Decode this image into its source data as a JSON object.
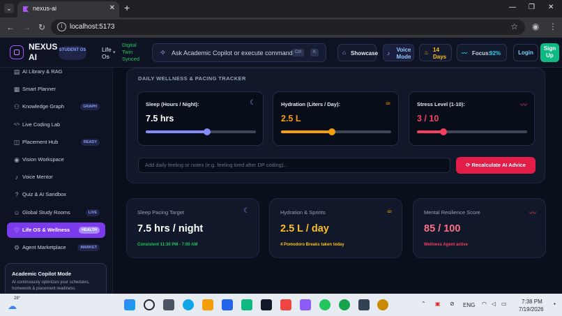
{
  "browser": {
    "tab_title": "nexus-ai",
    "url": "localhost:5173"
  },
  "topnav": {
    "brand": "NEXUS AI",
    "student_badge": "STUDENT OS",
    "life_os": "Life Os",
    "twin_status": "Digital Twin Synced",
    "command_placeholder": "Ask Academic Copilot or execute command...",
    "kbd_ctrl": "Ctrl",
    "kbd_k": "K",
    "showcase": "Showcase",
    "voice_mode": "Voice Mode",
    "streak": "14 Days",
    "focus_label": "Focus:",
    "focus_value": "92%",
    "login": "Login",
    "signup": "Sign Up"
  },
  "sidebar": {
    "items": [
      {
        "label": "AI Library & RAG",
        "icon": "book-icon"
      },
      {
        "label": "Smart Planner",
        "icon": "calendar-icon"
      },
      {
        "label": "Knowledge Graph",
        "icon": "graph-icon",
        "badge": "GRAPH"
      },
      {
        "label": "Live Coding Lab",
        "icon": "code-icon"
      },
      {
        "label": "Placement Hub",
        "icon": "briefcase-icon",
        "badge": "READY"
      },
      {
        "label": "Vision Workspace",
        "icon": "eye-icon"
      },
      {
        "label": "Voice Mentor",
        "icon": "mic-icon"
      },
      {
        "label": "Quiz & AI Sandbox",
        "icon": "help-icon"
      },
      {
        "label": "Global Study Rooms",
        "icon": "users-icon",
        "badge": "LIVE"
      },
      {
        "label": "Life OS & Wellness",
        "icon": "heart-icon",
        "badge": "HEALTH",
        "active": true
      },
      {
        "label": "Agent Marketplace",
        "icon": "robot-icon",
        "badge": "MARKET"
      }
    ],
    "copilot_title": "Academic Copilot Mode",
    "copilot_text": "AI continuously optimizes your schedules, homework & placement readiness."
  },
  "tracker": {
    "title": "DAILY WELLNESS & PACING TRACKER",
    "metrics": [
      {
        "label": "Sleep (Hours / Night):",
        "value": "7.5 hrs",
        "level": 0.56,
        "color": "#818cf8",
        "icon": "moon-icon"
      },
      {
        "label": "Hydration (Liters / Day):",
        "value": "2.5 L",
        "level": 0.46,
        "color": "#f59e0b",
        "icon": "cup-icon"
      },
      {
        "label": "Stress Level (1-10):",
        "value": "3 / 10",
        "level": 0.24,
        "color": "#f43f5e",
        "icon": "pulse-icon"
      }
    ],
    "notes_placeholder": "Add daily feeling or notes (e.g. feeling tired after DP coding)...",
    "recalc_label": "Recalculate AI Advice"
  },
  "cards": [
    {
      "title": "Sleep Pacing Target",
      "value": "7.5 hrs / night",
      "sub": "Consistent 11:30 PM - 7:00 AM",
      "value_color": "#ffffff",
      "sub_color": "#22c55e",
      "icon": "moon-icon",
      "icon_color": "#818cf8"
    },
    {
      "title": "Hydration & Sprints",
      "value": "2.5 L / day",
      "sub": "4 Pomodoro Breaks taken today",
      "value_color": "#fbbf24",
      "sub_color": "#fbbf24",
      "icon": "cup-icon",
      "icon_color": "#f59e0b"
    },
    {
      "title": "Mental Resilience Score",
      "value": "85 / 100",
      "sub": "Wellness Agent active",
      "value_color": "#fb7185",
      "sub_color": "#f43f5e",
      "icon": "pulse-icon",
      "icon_color": "#f43f5e"
    }
  ],
  "taskbar": {
    "weather": "28°",
    "lang": "ENG",
    "time": "7:38 PM",
    "date": "7/19/2026"
  }
}
